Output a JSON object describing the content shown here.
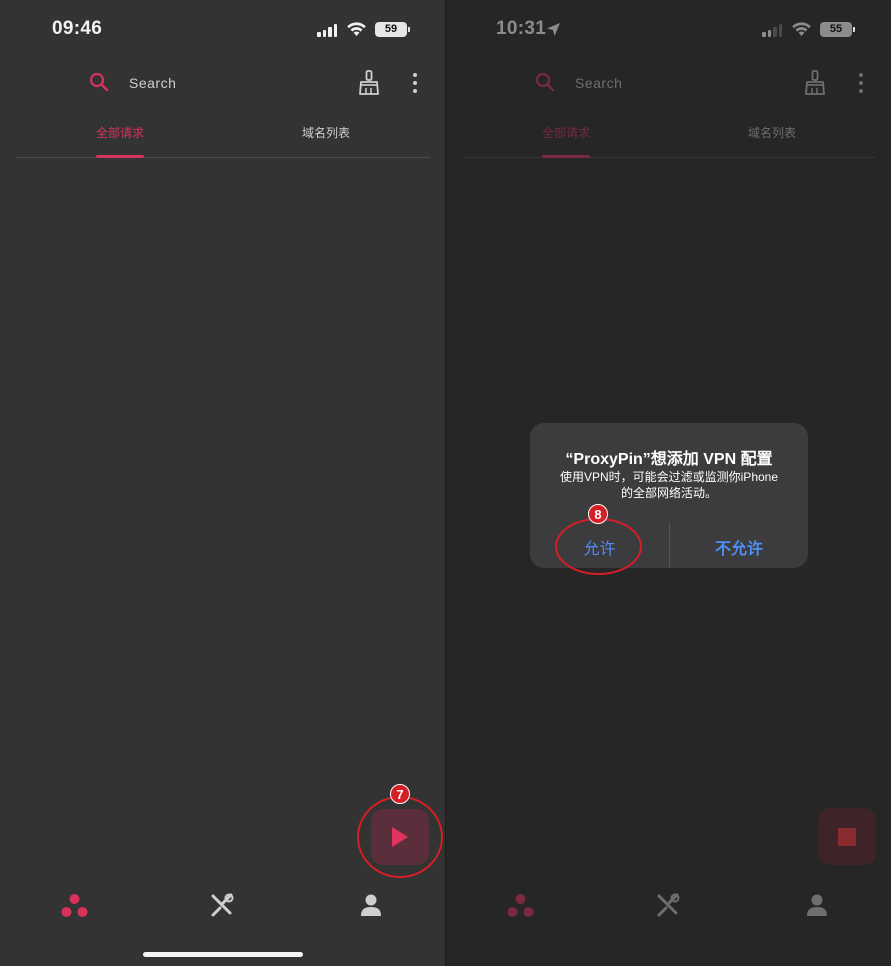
{
  "left": {
    "status": {
      "time": "09:46",
      "battery": "59"
    },
    "search": {
      "placeholder": "Search"
    },
    "tabs": [
      {
        "label": "全部请求",
        "active": true
      },
      {
        "label": "域名列表",
        "active": false
      }
    ],
    "annotation": "7",
    "fab_icon": "play-icon"
  },
  "right": {
    "status": {
      "time": "10:31",
      "battery": "55"
    },
    "search": {
      "placeholder": "Search"
    },
    "tabs": [
      {
        "label": "全部请求",
        "active": true
      },
      {
        "label": "域名列表",
        "active": false
      }
    ],
    "dialog": {
      "title": "“ProxyPin”想添加 VPN 配置",
      "message": "使用VPN时，可能会过滤或监测你iPhone的全部网络活动。",
      "allow": "允许",
      "deny": "不允许"
    },
    "annotation": "8",
    "fab_icon": "stop-icon"
  },
  "nav": [
    "network-icon",
    "tools-icon",
    "person-icon"
  ],
  "colors": {
    "accent": "#d6335d",
    "ios_blue": "#4d8ef7",
    "annotation_red": "#d51f27"
  }
}
